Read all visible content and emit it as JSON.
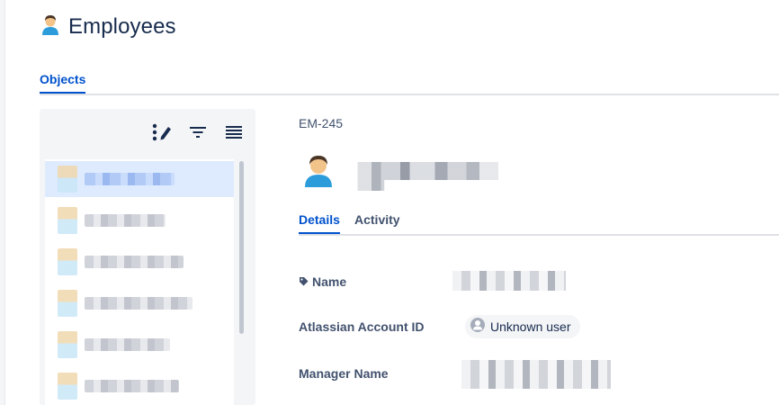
{
  "header": {
    "title": "Employees",
    "icon": "person-icon"
  },
  "tabs": {
    "objects": "Objects"
  },
  "toolbar": {
    "icons": [
      "edit-list-icon",
      "filter-icon",
      "list-view-icon"
    ]
  },
  "object": {
    "key": "EM-245",
    "tabs": {
      "details": "Details",
      "activity": "Activity"
    },
    "attributes": {
      "name_label": "Name",
      "account_label": "Atlassian Account ID",
      "account_value": "Unknown user",
      "manager_label": "Manager Name"
    }
  },
  "colors": {
    "accent": "#0052cc",
    "selected_row": "#deebff",
    "panel_bg": "#f4f5f7"
  }
}
